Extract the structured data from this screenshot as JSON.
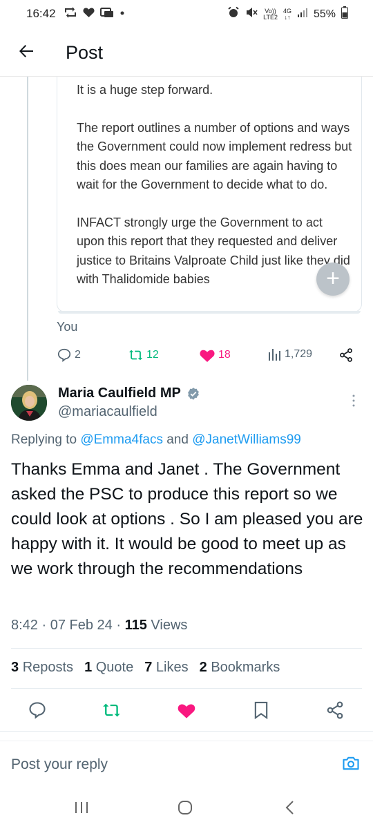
{
  "status_bar": {
    "time": "16:42",
    "volte": "Vo))",
    "lte": "LTE2",
    "network": "4G",
    "battery": "55%"
  },
  "header": {
    "title": "Post"
  },
  "quoted_post": {
    "paragraphs": [
      "It is a huge step forward.",
      "The report outlines a number of options and ways the Government could now implement redress but this does mean our families are again having to wait for the Government to decide what to do.",
      "INFACT strongly urge the Government to act upon this report that they requested and deliver justice to Britains Valproate Child just like they did with Thalidomide babies"
    ],
    "author_label": "You"
  },
  "parent_actions": {
    "replies": "2",
    "reposts": "12",
    "likes": "18",
    "views": "1,729"
  },
  "post": {
    "name": "Maria Caulfield MP",
    "handle": "@mariacaulfield",
    "replying_prefix": "Replying to",
    "replying_user1": "@Emma4facs",
    "replying_and": "and",
    "replying_user2": "@JanetWilliams99",
    "text": "Thanks Emma and Janet . The Government asked the PSC to produce this report so we could look at options . So I am pleased you are happy with it. It would be good to meet up as we work through the recommendations",
    "time": "8:42",
    "date": "07 Feb 24",
    "views_count": "115",
    "views_label": "Views"
  },
  "stats": {
    "reposts_count": "3",
    "reposts_label": "Reposts",
    "quotes_count": "1",
    "quotes_label": "Quote",
    "likes_count": "7",
    "likes_label": "Likes",
    "bookmarks_count": "2",
    "bookmarks_label": "Bookmarks"
  },
  "reply_bar": {
    "placeholder": "Post your reply"
  },
  "colors": {
    "accent": "#1d9bf0",
    "like": "#f91880",
    "repost": "#00ba7c",
    "muted": "#536471"
  }
}
